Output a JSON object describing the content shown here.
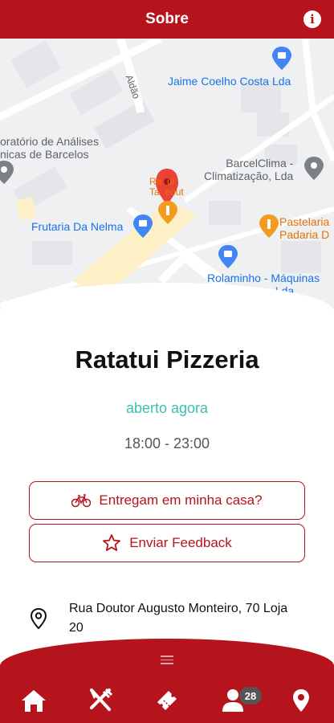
{
  "header": {
    "title": "Sobre",
    "info_icon": "info-icon"
  },
  "map": {
    "street_label": "Aldão",
    "places": [
      {
        "name": "Jaime Coelho Costa Lda",
        "icon": "shopping-bag-icon"
      },
      {
        "name": "oratório de Análises\nnicas de Barcelos",
        "icon": "location-icon"
      },
      {
        "name": "BarcelClima -\nClimatização, Lda",
        "icon": "location-icon"
      },
      {
        "name": "Ra  ui\nTa  eout",
        "icon": "restaurant-icon"
      },
      {
        "name": "Frutaria Da Nelma",
        "icon": "shopping-bag-icon"
      },
      {
        "name": "Pastelaria\nPadaria D",
        "icon": "restaurant-icon"
      },
      {
        "name": "Rolaminho - Máquinas\n        mentas, Lda",
        "icon": "shopping-bag-icon"
      }
    ]
  },
  "restaurant": {
    "name": "Ratatui Pizzeria",
    "status": "aberto agora",
    "hours": "18:00 - 23:00",
    "status_color": "#3dbdb2"
  },
  "actions": {
    "delivery_label": "Entregam em minha casa?",
    "feedback_label": "Enviar Feedback"
  },
  "address": "Rua Doutor Augusto Monteiro, 70 Loja 20",
  "nav": {
    "items": [
      "home-icon",
      "restaurant-icon",
      "ticket-icon",
      "users-icon",
      "location-icon"
    ],
    "users_badge": "28"
  },
  "colors": {
    "brand": "#b5141c",
    "accent_teal": "#3dbdb2"
  }
}
